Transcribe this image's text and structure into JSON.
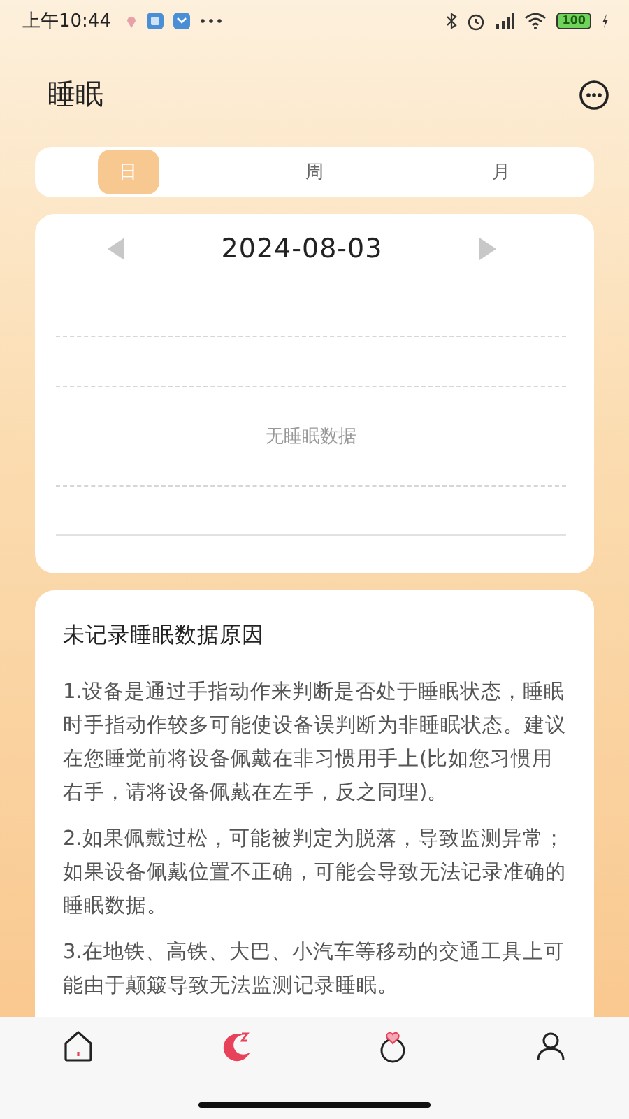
{
  "status_bar": {
    "time": "上午10:44",
    "battery": "100"
  },
  "header": {
    "title": "睡眠"
  },
  "tabs": [
    {
      "label": "日",
      "selected": true
    },
    {
      "label": "周",
      "selected": false
    },
    {
      "label": "月",
      "selected": false
    }
  ],
  "date_card": {
    "date": "2024-08-03",
    "empty_message": "无睡眠数据"
  },
  "reasons": {
    "title": "未记录睡眠数据原因",
    "paragraphs": [
      "1.设备是通过手指动作来判断是否处于睡眠状态，睡眠时手指动作较多可能使设备误判断为非睡眠状态。建议在您睡觉前将设备佩戴在非习惯用手上(比如您习惯用右手，请将设备佩戴在左手，反之同理)。",
      "2.如果佩戴过松，可能被判定为脱落，导致监测异常；如果设备佩戴位置不正确，可能会导致无法记录准确的睡眠数据。",
      "3.在地铁、高铁、大巴、小汽车等移动的交通工具上可能由于颠簸导致无法监测记录睡眠。"
    ]
  },
  "nav": [
    {
      "kind": "home",
      "selected": false
    },
    {
      "kind": "sleep",
      "selected": true
    },
    {
      "kind": "health",
      "selected": false
    },
    {
      "kind": "profile",
      "selected": false
    }
  ]
}
